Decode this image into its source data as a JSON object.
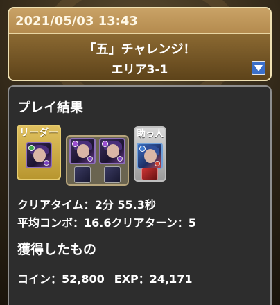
{
  "header": {
    "datetime": "2021/05/03 13:43",
    "quest_title": "「五」チャレンジ！",
    "area": "エリア3-1",
    "dropdown_icon": "triangle-down-icon"
  },
  "results": {
    "section_title": "プレイ結果",
    "leader_label": "リーダー",
    "helper_label": "助っ人",
    "clear_time_label": "クリアタイム：",
    "clear_time_value": "2分 55.3秒",
    "avg_combo_label": "平均コンボ：",
    "avg_combo_value": "16.6",
    "clear_turn_label": "クリアターン：",
    "clear_turn_value": "5"
  },
  "rewards": {
    "section_title": "獲得したもの",
    "coin_label": "コイン：",
    "coin_value": "52,800",
    "exp_label": "EXP：",
    "exp_value": "24,171"
  },
  "colors": {
    "header_gold": "#c9a266",
    "leader_gold": "#e0c160",
    "panel_bg": "#2d2d2d",
    "dropdown_blue": "#3b6fc9"
  }
}
